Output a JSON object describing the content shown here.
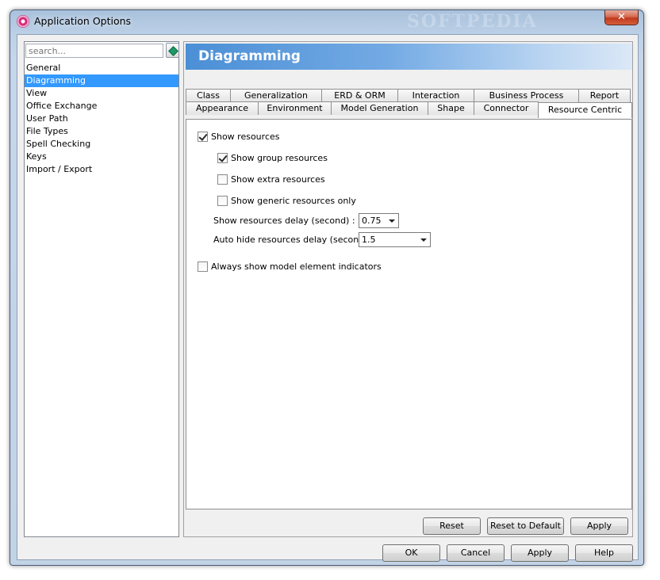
{
  "window": {
    "title": "Application Options",
    "watermark": "SOFTPEDIA",
    "close_glyph": "✕"
  },
  "sidebar": {
    "search_placeholder": "search...",
    "items": [
      {
        "label": "General",
        "selected": false
      },
      {
        "label": "Diagramming",
        "selected": true
      },
      {
        "label": "View",
        "selected": false
      },
      {
        "label": "Office Exchange",
        "selected": false
      },
      {
        "label": "User Path",
        "selected": false
      },
      {
        "label": "File Types",
        "selected": false
      },
      {
        "label": "Spell Checking",
        "selected": false
      },
      {
        "label": "Keys",
        "selected": false
      },
      {
        "label": "Import / Export",
        "selected": false
      }
    ]
  },
  "header": {
    "title": "Diagramming"
  },
  "tabs": {
    "row1": [
      "Class",
      "Generalization",
      "ERD & ORM",
      "Interaction",
      "Business Process",
      "Report"
    ],
    "row2": [
      "Appearance",
      "Environment",
      "Model Generation",
      "Shape",
      "Connector",
      "Resource Centric"
    ],
    "active": "Resource Centric"
  },
  "options": {
    "show_resources": {
      "label": "Show resources",
      "checked": true
    },
    "show_group_resources": {
      "label": "Show group resources",
      "checked": true
    },
    "show_extra_resources": {
      "label": "Show extra resources",
      "checked": false
    },
    "show_generic_resources_only": {
      "label": "Show generic resources only",
      "checked": false
    },
    "show_resources_delay": {
      "label": "Show resources delay (second) :",
      "value": "0.75"
    },
    "auto_hide_delay": {
      "label": "Auto hide resources delay (second) :",
      "value": "1.5"
    },
    "always_show_indicators": {
      "label": "Always show model element indicators",
      "checked": false
    }
  },
  "panel_buttons": {
    "reset": "Reset",
    "reset_default": "Reset to Default",
    "apply": "Apply"
  },
  "dialog_buttons": {
    "ok": "OK",
    "cancel": "Cancel",
    "apply": "Apply",
    "help": "Help"
  },
  "colors": {
    "selection": "#3399ff",
    "banner_start": "#4b8fd6",
    "banner_end": "#dbe8f7"
  }
}
